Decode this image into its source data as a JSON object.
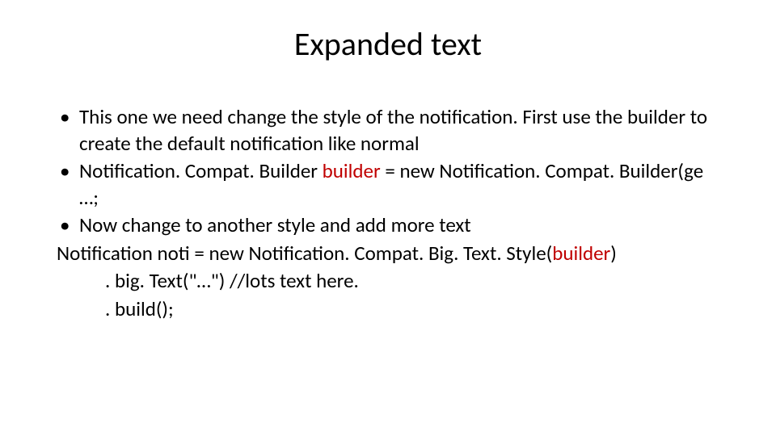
{
  "title": "Expanded text",
  "b1": "This one we need change the style of the notification.  First use the builder to create the default notification like normal",
  "b2a": "Notification. Compat. Builder ",
  "b2_builder": "builder",
  "b2b": " = new Notification. Compat. Builder(ge …;",
  "b3": "Now change to another style and add more text",
  "l1a": "Notification noti = new Notification. Compat. Big. Text. Style(",
  "l1_builder": "builder",
  "l1b": ")",
  "l2": ". big. Text(\"…\")  //lots text here.",
  "l3": ". build();",
  "bullet": "•"
}
